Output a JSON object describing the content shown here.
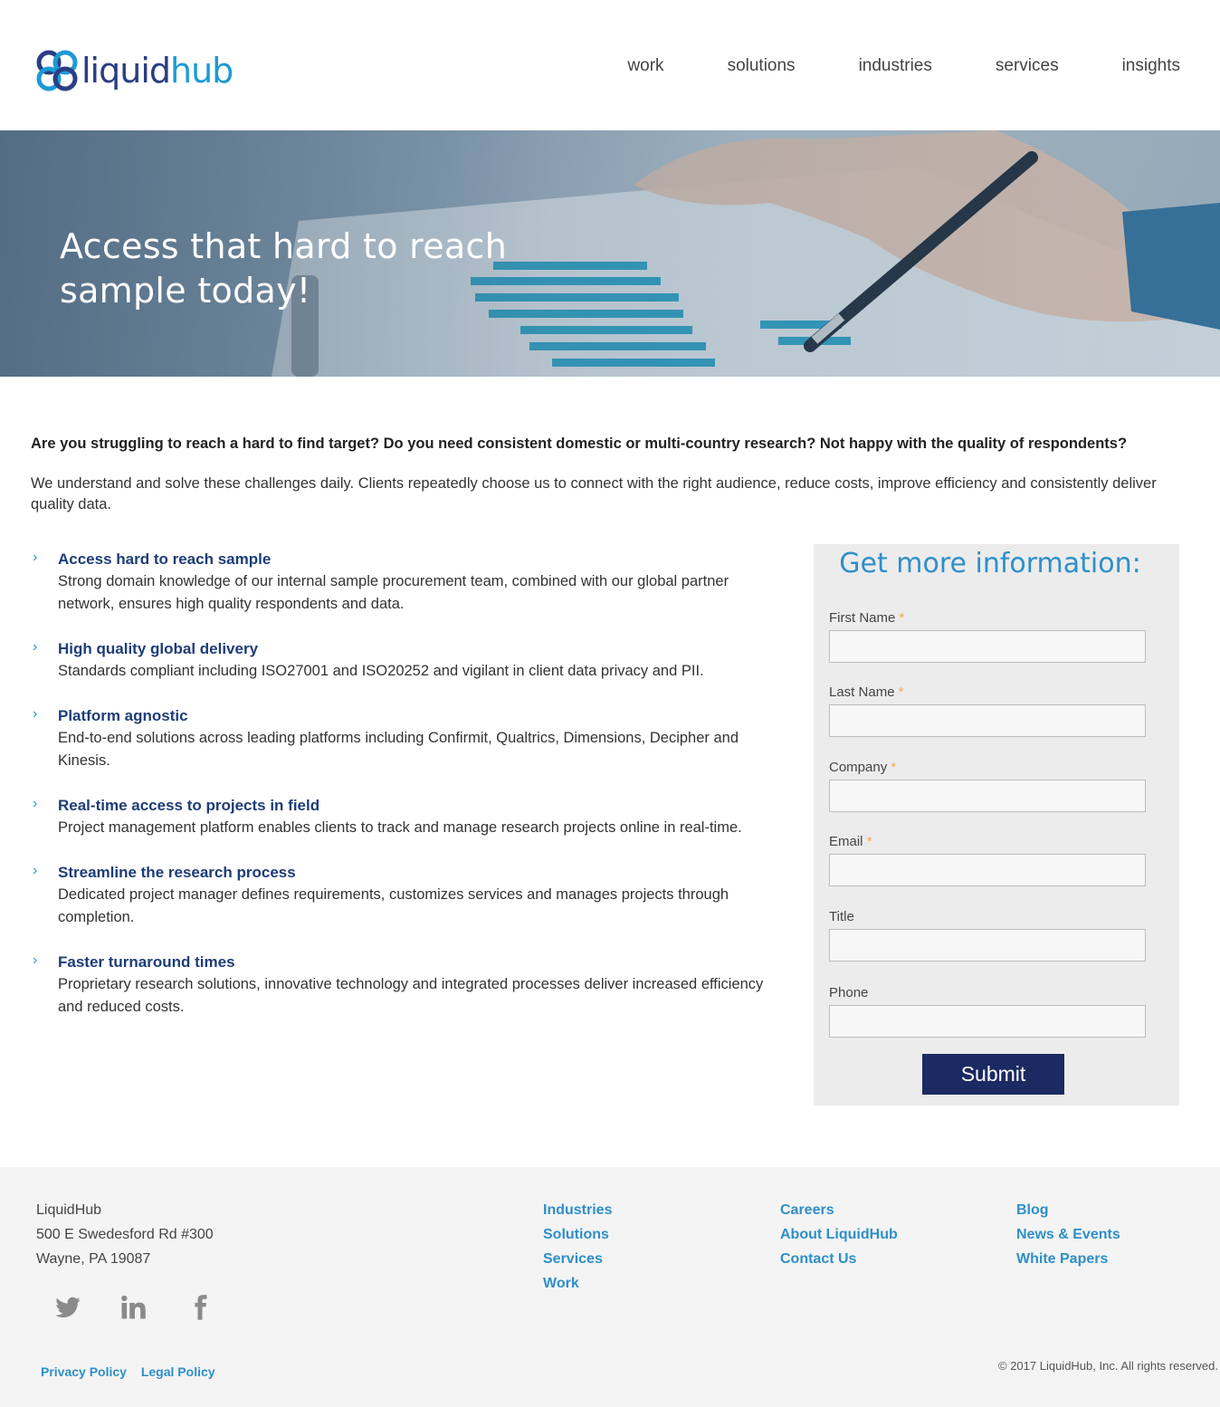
{
  "header": {
    "logo_text_a": "liquid",
    "logo_text_b": "hub",
    "nav": [
      "work",
      "solutions",
      "industries",
      "services",
      "insights"
    ]
  },
  "hero": {
    "title_line1": "Access that hard to reach",
    "title_line2": "sample today!"
  },
  "intro": {
    "question": "Are you struggling to reach a hard to find target? Do you need consistent domestic or multi-country research? Not happy with the quality of respondents?",
    "paragraph": "We understand and solve these challenges daily. Clients repeatedly choose us to connect with the right audience, reduce costs, improve efficiency and consistently deliver quality data."
  },
  "features": [
    {
      "title": "Access hard to reach sample",
      "text": "Strong domain knowledge of our internal sample procurement team, combined with our global partner network, ensures high quality respondents and data."
    },
    {
      "title": "High quality global delivery",
      "text": "Standards compliant including ISO27001 and ISO20252 and vigilant in client data privacy and PII."
    },
    {
      "title": "Platform agnostic",
      "text": "End-to-end solutions across leading platforms including Confirmit, Qualtrics, Dimensions, Decipher and Kinesis."
    },
    {
      "title": "Real-time access to projects in field",
      "text": "Project management platform enables clients to track and manage research projects online in real-time."
    },
    {
      "title": "Streamline the research process",
      "text": "Dedicated project manager defines requirements, customizes services and manages projects through completion."
    },
    {
      "title": "Faster turnaround times",
      "text": "Proprietary research solutions, innovative technology and integrated processes deliver increased efficiency and reduced costs."
    }
  ],
  "form": {
    "title": "Get more information:",
    "fields": [
      {
        "label": "First Name",
        "required_mark": "*"
      },
      {
        "label": "Last Name",
        "required_mark": "*"
      },
      {
        "label": "Company",
        "required_mark": "*"
      },
      {
        "label": "Email",
        "required_mark": "*"
      },
      {
        "label": "Title",
        "required_mark": ""
      },
      {
        "label": "Phone",
        "required_mark": ""
      }
    ],
    "submit_label": "Submit"
  },
  "footer": {
    "address": [
      "LiquidHub",
      "500 E Swedesford Rd #300",
      "Wayne, PA 19087"
    ],
    "col1": [
      "Industries",
      "Solutions",
      "Services",
      "Work"
    ],
    "col2": [
      "Careers",
      "About LiquidHub",
      "Contact Us"
    ],
    "col3": [
      "Blog",
      "News & Events",
      "White Papers"
    ],
    "policies": [
      "Privacy Policy",
      "Legal Policy"
    ],
    "copyright": "© 2017 LiquidHub, Inc. All rights reserved.",
    "social_icons": [
      "twitter-icon",
      "linkedin-icon",
      "facebook-icon"
    ]
  },
  "colors": {
    "brand_navy": "#1b2a62",
    "brand_blue": "#2e8fc9",
    "feature_title": "#1d3c78",
    "required_star": "#f0a94a"
  }
}
